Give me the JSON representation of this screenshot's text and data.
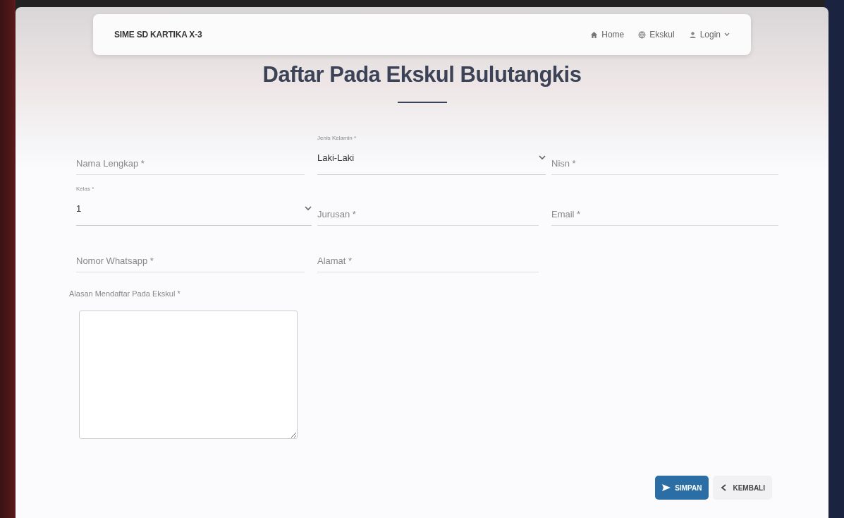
{
  "navbar": {
    "brand": "SIME SD KARTIKA X-3",
    "links": [
      {
        "kind": "home",
        "label": "Home",
        "dropdown": false
      },
      {
        "kind": "globe",
        "label": "Ekskul",
        "dropdown": false
      },
      {
        "kind": "user",
        "label": "Login",
        "dropdown": true
      }
    ]
  },
  "title": "Daftar Pada Ekskul Bulutangkis",
  "form_rows": [
    [
      {
        "kind": "input",
        "placeholder": "Nama Lengkap *"
      },
      {
        "kind": "select",
        "label": "Jenis Kelamin *",
        "value": "Laki-Laki"
      },
      {
        "kind": "input",
        "placeholder": "Nisn *"
      }
    ],
    [
      {
        "kind": "select",
        "label": "Kelas *",
        "value": "1"
      },
      {
        "kind": "input",
        "placeholder": "Jurusan *"
      },
      {
        "kind": "input",
        "placeholder": "Email *"
      }
    ],
    [
      {
        "kind": "input",
        "placeholder": "Nomor Whatsapp *"
      },
      {
        "kind": "input",
        "placeholder": "Alamat *"
      }
    ]
  ],
  "reason": {
    "label": "Alasan Mendaftar Pada Ekskul *"
  },
  "buttons": [
    {
      "kind": "primary",
      "label": "SIMPAN"
    },
    {
      "kind": "back",
      "label": "KEMBALI"
    }
  ]
}
